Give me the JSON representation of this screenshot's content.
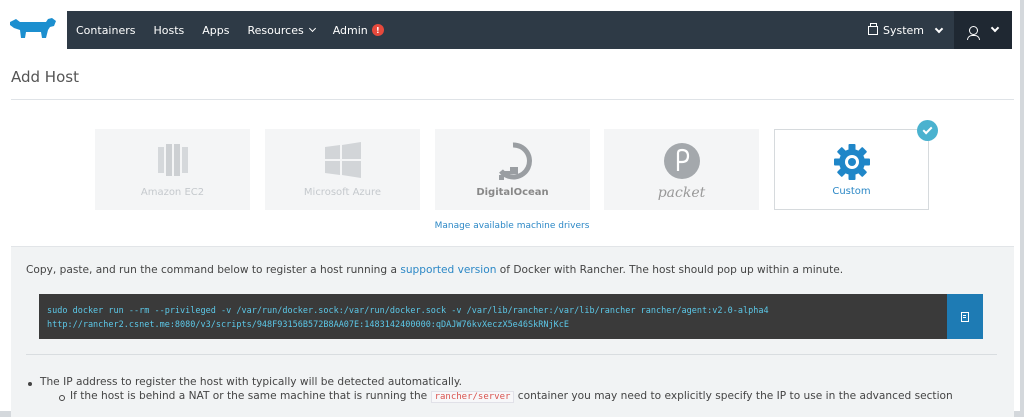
{
  "nav": {
    "items": [
      {
        "label": "Containers"
      },
      {
        "label": "Hosts"
      },
      {
        "label": "Apps"
      },
      {
        "label": "Resources"
      },
      {
        "label": "Admin"
      }
    ],
    "admin_badge": "!",
    "environment": "System"
  },
  "page": {
    "title": "Add Host"
  },
  "drivers": [
    {
      "label": "Amazon EC2",
      "icon": "amazon-ec2-icon"
    },
    {
      "label": "Microsoft Azure",
      "icon": "microsoft-azure-icon"
    },
    {
      "label": "DigitalOcean",
      "icon": "digitalocean-icon"
    },
    {
      "label": "packet",
      "icon": "packet-icon"
    },
    {
      "label": "Custom",
      "icon": "gear-icon",
      "selected": true
    }
  ],
  "manage_link": "Manage available machine drivers",
  "instructions": {
    "before": "Copy, paste, and run the command below to register a host running a ",
    "link": "supported version",
    "after": " of Docker with Rancher. The host should pop up within a minute."
  },
  "command": {
    "line1": "sudo docker run --rm --privileged -v /var/run/docker.sock:/var/run/docker.sock -v /var/lib/rancher:/var/lib/rancher rancher/agent:v2.0-alpha4",
    "line2": "http://rancher2.csnet.me:8080/v3/scripts/948F93156B572B8AA07E:1483142400000:qDAJW76kvXeczX5e46SkRNjKcE"
  },
  "notes": {
    "item1": "The IP address to register the host with typically will be detected automatically.",
    "item2_before": "If the host is behind a NAT or the same machine that is running the ",
    "item2_code": "rancher/server",
    "item2_after": " container you may need to explicitly specify the IP to use in the advanced section"
  },
  "colors": {
    "nav_bg": "#2e3a46",
    "accent": "#2c88c6",
    "copy_button": "#1e7bb4",
    "badge": "#e6493c",
    "check": "#4ab2cf"
  }
}
